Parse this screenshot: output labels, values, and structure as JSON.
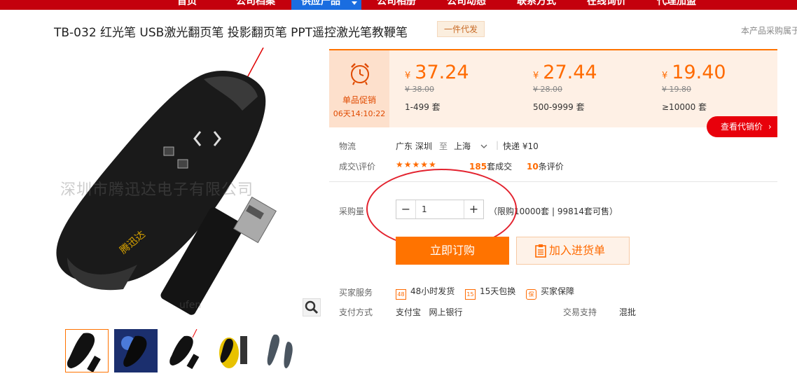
{
  "nav": {
    "items": [
      "首页",
      "公司档案",
      "供应产品",
      "公司相册",
      "公司动态",
      "联系方式",
      "在线询价",
      "代理加盟"
    ]
  },
  "product": {
    "title": "TB-032 红光笔 USB激光翻页笔 投影翻页笔 PPT遥控激光笔教鞭笔",
    "tag": "一件代发",
    "right_note": "本产品采购属于"
  },
  "gallery": {
    "watermark": "深圳市腾迅达电子有限公司",
    "watermark_url": "ufen",
    "thumb_count": 5
  },
  "promo": {
    "label": "单品促销",
    "countdown": "06天14:10:22"
  },
  "price_tiers": [
    {
      "currency": "¥",
      "price": "37.24",
      "original": "¥ 38.00",
      "range": "1-499 套"
    },
    {
      "currency": "¥",
      "price": "27.44",
      "original": "¥ 28.00",
      "range": "500-9999 套"
    },
    {
      "currency": "¥",
      "price": "19.40",
      "original": "¥ 19.80",
      "range": "≥10000 套"
    }
  ],
  "agent_price_button": "查看代销价",
  "logistics": {
    "label": "物流",
    "from": "广东 深圳",
    "to_word": "至",
    "to": "上海",
    "express": "快递 ¥10"
  },
  "deals": {
    "label": "成交\\评价",
    "stars": "★★★★★",
    "sold_count": "185",
    "sold_suffix": "套成交",
    "review_count": "10",
    "review_suffix": "条评价"
  },
  "quantity": {
    "label": "采购量",
    "minus": "−",
    "value": "1",
    "plus": "+",
    "limit_text": "（限购10000套 | 99814套可售）"
  },
  "buttons": {
    "order": "立即订购",
    "cart": "加入进货单"
  },
  "services": {
    "label": "买家服务",
    "items": [
      {
        "badge": "48",
        "text": "48小时发货"
      },
      {
        "badge": "15",
        "text": "15天包换"
      },
      {
        "badge": "保",
        "text": "买家保障"
      }
    ]
  },
  "payment": {
    "label": "支付方式",
    "methods": "支付宝   网上银行",
    "trade_label": "交易支持",
    "trade_value": "混批"
  },
  "colors": {
    "accent": "#ff7300",
    "nav_red": "#c4000d",
    "nav_active": "#1a6de0"
  }
}
